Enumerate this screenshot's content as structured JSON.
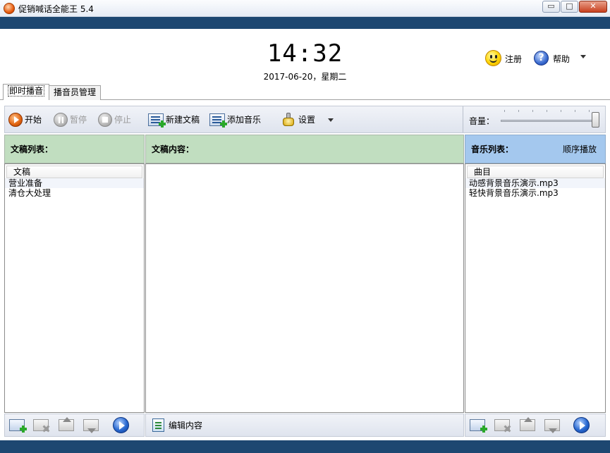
{
  "window": {
    "title": "促销喊话全能王 5.4",
    "controls": {
      "minimize": "▭",
      "maximize": "□",
      "close": "✕"
    }
  },
  "header": {
    "clock": "14:32",
    "date": "2017-06-20，星期二",
    "register_label": "注册",
    "help_label": "帮助",
    "help_glyph": "?"
  },
  "tabs": [
    {
      "label": "即时播音",
      "active": true
    },
    {
      "label": "播音员管理",
      "active": false
    }
  ],
  "toolbar": {
    "start": "开始",
    "pause": "暂停",
    "stop": "停止",
    "new_script": "新建文稿",
    "add_music": "添加音乐",
    "settings": "设置",
    "volume_label": "音量：",
    "volume_level": 1.0
  },
  "scripts_panel": {
    "title": "文稿列表：",
    "column": "文稿",
    "items": [
      "营业准备",
      "清仓大处理"
    ]
  },
  "content_panel": {
    "title": "文稿内容：",
    "edit_button": "编辑内容"
  },
  "music_panel": {
    "title": "音乐列表：",
    "play_mode": "顺序播放",
    "column": "曲目",
    "items": [
      "动感背景音乐演示.mp3",
      "轻快背景音乐演示.mp3"
    ]
  },
  "colors": {
    "band": "#1d4771",
    "panel_green": "#c1dec0",
    "panel_blue": "#a4c8ee"
  }
}
